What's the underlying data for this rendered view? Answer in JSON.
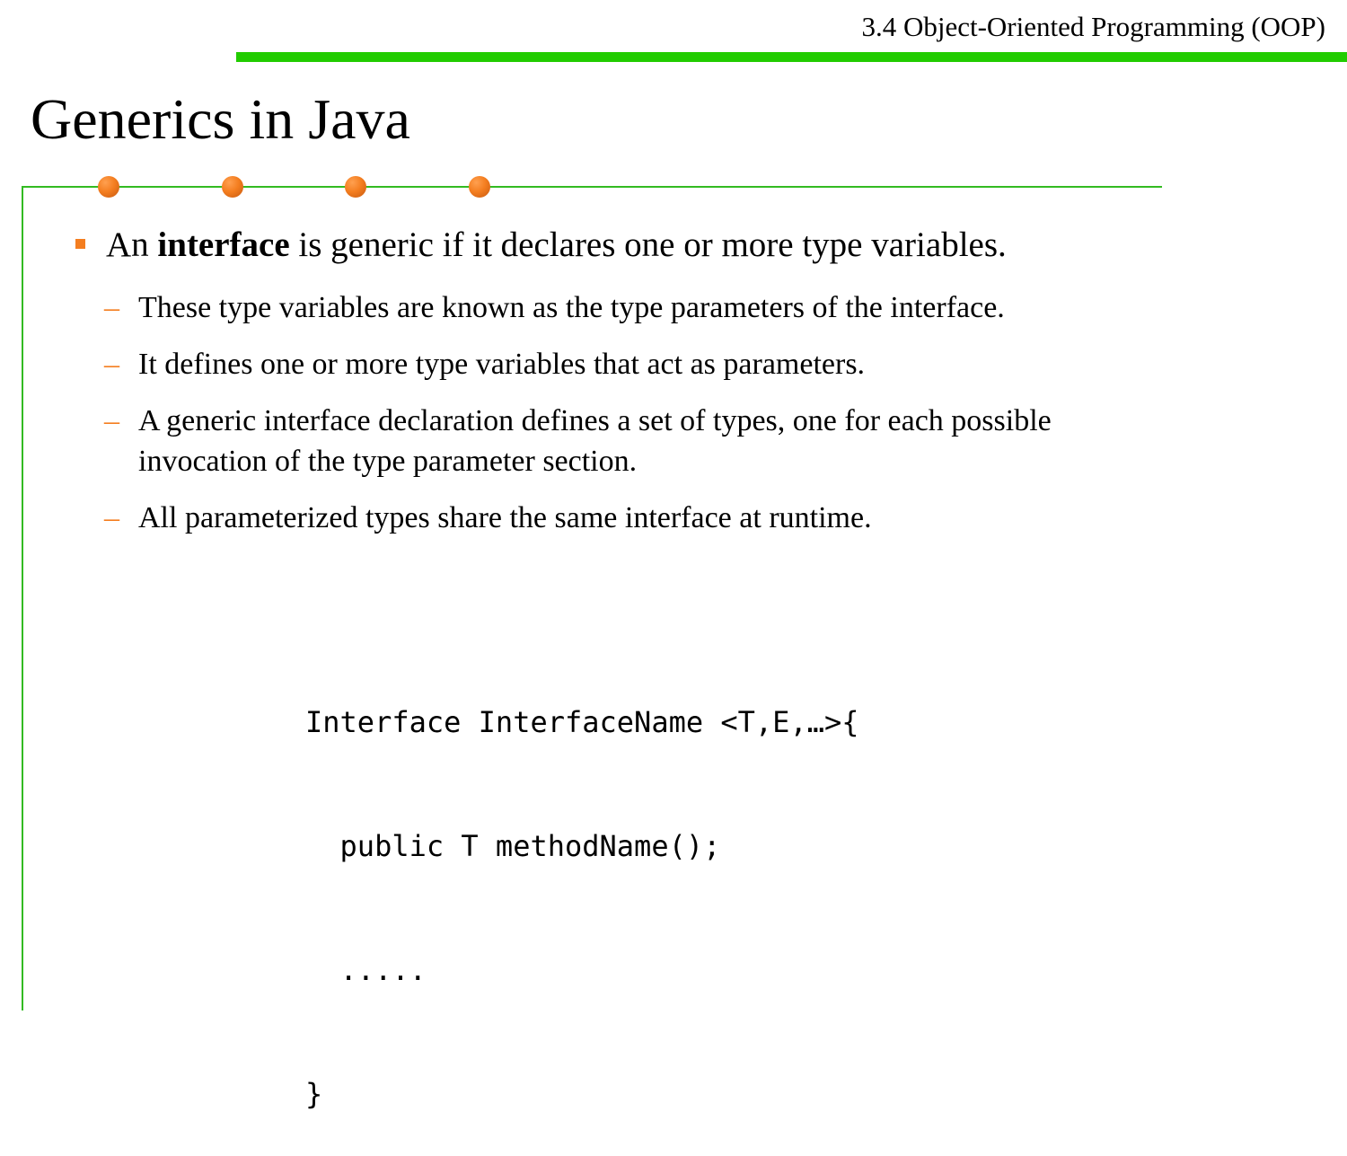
{
  "header": {
    "section": "3.4 Object-Oriented Programming (OOP)"
  },
  "slide": {
    "title": "Generics in Java"
  },
  "bullet": {
    "prefix": "An ",
    "emphasis": "interface",
    "suffix": " is generic if it declares one or more type variables."
  },
  "sub_bullets": [
    {
      "line1": "These type variables are known as the type parameters of the interface."
    },
    {
      "line1": "It defines one or more type variables that act as parameters."
    },
    {
      "line1": "A generic interface declaration defines a set of types, one for each possible",
      "line2": "invocation of the type parameter section."
    },
    {
      "line1": "All parameterized types share the same interface at runtime."
    }
  ],
  "dash_symbol": "–",
  "code_lines": [
    "Interface InterfaceName <T,E,…>{",
    "  public T methodName();",
    "  .....",
    "}"
  ],
  "colors": {
    "header_bar": "#22cc00",
    "frame_line": "#33bb22",
    "accent_orange": "#f47e20",
    "dot_light": "#ffa050",
    "dot_dark": "#c85a10"
  }
}
